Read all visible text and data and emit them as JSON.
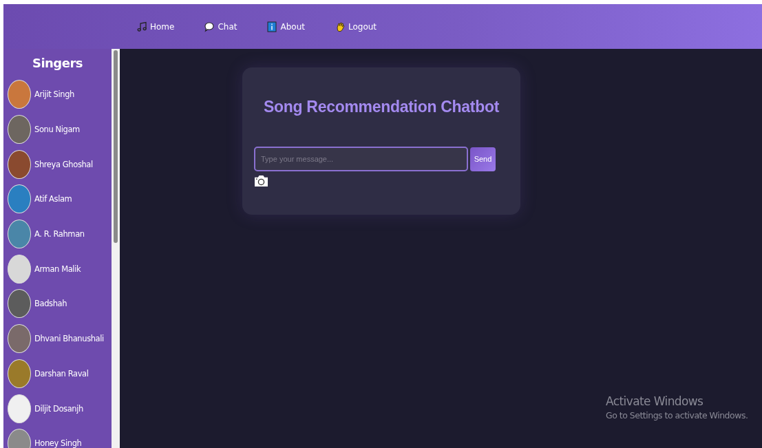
{
  "nav": [
    {
      "label": "Home",
      "kind": "music"
    },
    {
      "label": "Chat",
      "kind": "chat"
    },
    {
      "label": "About",
      "kind": "info"
    },
    {
      "label": "Logout",
      "kind": "wave"
    }
  ],
  "sidebar": {
    "title": "Singers",
    "items": [
      {
        "name": "Arijit Singh"
      },
      {
        "name": "Sonu Nigam"
      },
      {
        "name": "Shreya Ghoshal"
      },
      {
        "name": "Atif Aslam"
      },
      {
        "name": "A. R. Rahman"
      },
      {
        "name": "Arman Malik"
      },
      {
        "name": "Badshah"
      },
      {
        "name": "Dhvani Bhanushali"
      },
      {
        "name": "Darshan Raval"
      },
      {
        "name": "Diljit Dosanjh"
      },
      {
        "name": "Honey Singh"
      }
    ]
  },
  "chat": {
    "title": "Song Recommendation Chatbot",
    "input": {
      "placeholder": "Type your message..."
    },
    "send_button": "Send"
  },
  "os_notice": {
    "title": "Activate Windows",
    "text": "Go to Settings to activate Windows."
  }
}
